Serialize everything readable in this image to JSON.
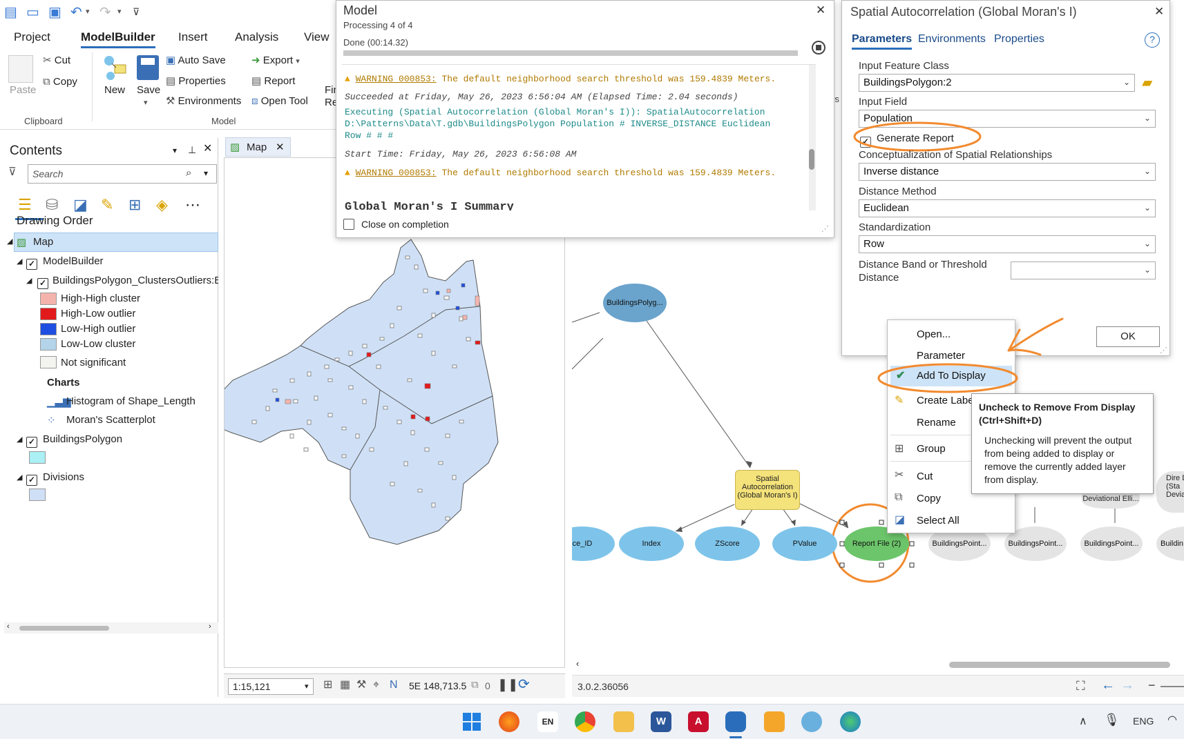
{
  "ribbon": {
    "tabs": [
      "Project",
      "ModelBuilder",
      "Insert",
      "Analysis",
      "View"
    ],
    "clipboard": {
      "paste": "Paste",
      "cut": "Cut",
      "copy": "Copy",
      "group": "Clipboard"
    },
    "model": {
      "new": "New",
      "save": "Save",
      "auto_save": "Auto Save",
      "properties": "Properties",
      "environments": "Environments",
      "export": "Export",
      "report": "Report",
      "open_tool": "Open Tool",
      "find": "Fin",
      "re": "Re",
      "group": "Model"
    }
  },
  "contents": {
    "title": "Contents",
    "search_placeholder": "Search",
    "drawing_order": "Drawing Order",
    "items": {
      "map": "Map",
      "modelbuilder": "ModelBuilder",
      "clusters_layer": "BuildingsPolygon_ClustersOutliers:Bu",
      "legend": [
        "High-High cluster",
        "High-Low outlier",
        "Low-High outlier",
        "Low-Low cluster",
        "Not significant"
      ],
      "charts": "Charts",
      "chart_items": [
        "Histogram of Shape_Length",
        "Moran's Scatterplot"
      ],
      "buildings": "BuildingsPolygon",
      "divisions": "Divisions"
    }
  },
  "map": {
    "tab": "Map",
    "scale": "1:15,121",
    "coords": "5E 148,713.5",
    "selected_count": "0"
  },
  "model_dialog": {
    "title": "Model",
    "subtitle": "Processing 4 of 4",
    "done": "Done (00:14.32)",
    "log": {
      "warn1_code": "WARNING 000853:",
      "warn1_text": "The default neighborhood search threshold was 159.4839 Meters.",
      "succeeded": "Succeeded at Friday, May 26, 2023 6:56:04 AM (Elapsed Time: 2.04 seconds)",
      "executing1": "Executing (Spatial Autocorrelation (Global Moran's I)): SpatialAutocorrelation",
      "executing2": "D:\\Patterns\\Data\\T.gdb\\BuildingsPolygon Population # INVERSE_DISTANCE Euclidean",
      "executing3": "Row # # #",
      "start_time": "Start Time: Friday, May 26, 2023 6:56:08 AM",
      "warn2_code": "WARNING 000853:",
      "warn2_text": "The default neighborhood search threshold was 159.4839 Meters.",
      "summary": "Global Moran's I Summary"
    },
    "close_on_completion": "Close on completion"
  },
  "sa_dialog": {
    "title": "Spatial Autocorrelation (Global Moran's I)",
    "tabs": [
      "Parameters",
      "Environments",
      "Properties"
    ],
    "input_feature_class_label": "Input Feature Class",
    "input_feature_class": "BuildingsPolygon:2",
    "input_field_label": "Input Field",
    "input_field": "Population",
    "generate_report": "Generate Report",
    "concept_label": "Conceptualization of Spatial Relationships",
    "concept": "Inverse distance",
    "distance_method_label": "Distance Method",
    "distance_method": "Euclidean",
    "standardization_label": "Standardization",
    "standardization": "Row",
    "distance_band_label1": "Distance Band or Threshold",
    "distance_band_label2": "Distance",
    "ok": "OK"
  },
  "model_canvas": {
    "nodes": {
      "buildings_polygon": "BuildingsPolyg...",
      "tool": "Spatial Autocorrelation (Global Moran's I)",
      "source_id": "ce_ID",
      "index": "Index",
      "zscore": "ZScore",
      "pvalue": "PValue",
      "report_file": "Report File (2)",
      "bp1": "BuildingsPoint...",
      "bp2": "BuildingsPoint...",
      "bp3": "BuildingsPoint...",
      "bp4": "Buildin",
      "dir": "Dire Dist (Sta Deviati",
      "std_ellipse": "Deviational Elli..."
    },
    "side_label": "rs"
  },
  "context_menu": {
    "items": [
      "Open...",
      "Parameter",
      "Add To Display",
      "Create Labe",
      "Rename",
      "Group",
      "Cut",
      "Copy",
      "Select All"
    ]
  },
  "tooltip": {
    "title": "Uncheck to Remove From Display (Ctrl+Shift+D)",
    "body": "Unchecking will prevent the output from being added to display or remove the currently added layer from display."
  },
  "status": {
    "version": "3.0.2.36056"
  },
  "taskbar": {
    "lang": "ENG",
    "en_badge": "EN"
  },
  "colors": {
    "accent": "#2a6ebb",
    "annotation": "#f28a2e",
    "selected_node": "#6cc56a",
    "output_node": "#7ec4ea",
    "tool_node": "#f4e27a"
  }
}
